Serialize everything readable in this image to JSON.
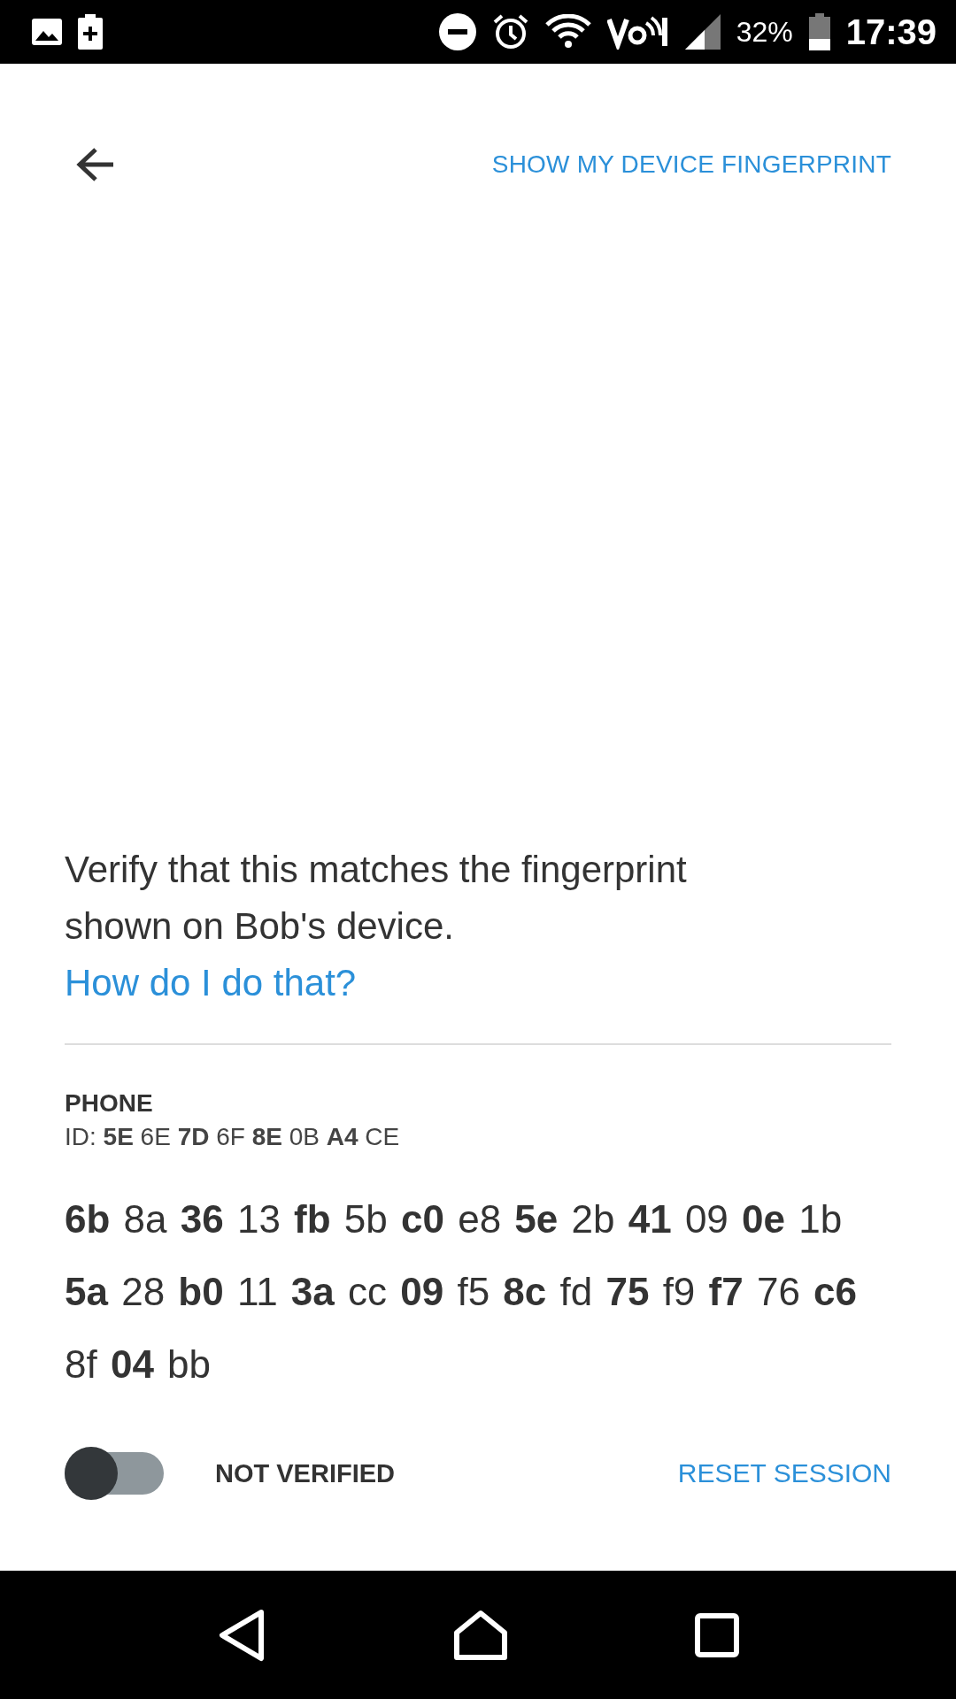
{
  "status_bar": {
    "battery_text": "32%",
    "time": "17:39"
  },
  "toolbar": {
    "action": "SHOW MY DEVICE FINGERPRINT"
  },
  "message": "Verify that this matches the fingerprint shown on Bob's device.",
  "help_link": "How do I do that?",
  "device": {
    "name": "PHONE",
    "id": "ID: **5E** 6E **7D** 6F **8E** 0B **A4** CE"
  },
  "fingerprint_lines": [
    "**6b** 8a **36** 13 **fb** 5b **c0** e8 **5e** 2b **41** 09 **0e** 1b",
    "**5a** 28 **b0** 11 **3a** cc **09** f5 **8c** fd **75** f9 **f7** 76 **c6**",
    "8f **04** bb"
  ],
  "verification": {
    "on": false,
    "label": "NOT VERIFIED",
    "reset": "RESET SESSION"
  }
}
